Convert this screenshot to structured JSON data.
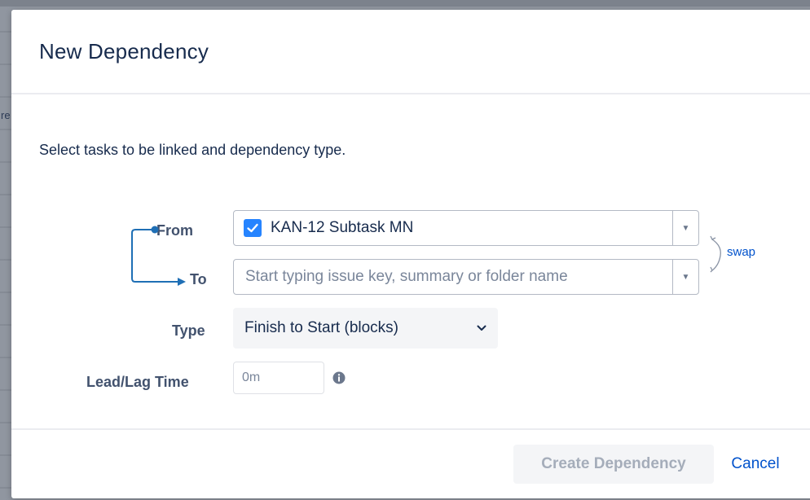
{
  "dialog": {
    "title": "New Dependency",
    "intro": "Select tasks to be linked and dependency type."
  },
  "form": {
    "from": {
      "label": "From",
      "value": "KAN-12  Subtask MN",
      "checked": true
    },
    "to": {
      "label": "To",
      "placeholder": "Start typing issue key, summary or folder name"
    },
    "swap_label": "swap",
    "type": {
      "label": "Type",
      "value": "Finish to Start (blocks)"
    },
    "lead_lag": {
      "label": "Lead/Lag Time",
      "placeholder": "0m"
    }
  },
  "footer": {
    "create_label": "Create Dependency",
    "cancel_label": "Cancel"
  },
  "backdrop": {
    "fragment": "re"
  },
  "colors": {
    "accent": "#2684ff",
    "link": "#0052cc",
    "title": "#172b4d",
    "label": "#42526e",
    "disabled_text": "#a5adba"
  },
  "icons": {
    "checkbox": "check-icon",
    "dropdown": "caret-down-icon",
    "swap": "swap-arrows-icon",
    "type_chevron": "chevron-down-icon",
    "info": "info-icon",
    "connector": "link-arrow-icon"
  }
}
